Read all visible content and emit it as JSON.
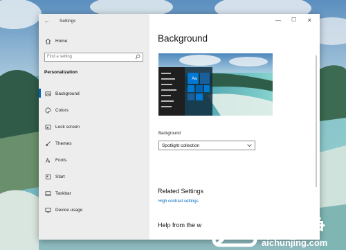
{
  "window": {
    "app_title": "Settings",
    "controls": {
      "minimize": "—",
      "maximize": "☐",
      "close": "✕"
    }
  },
  "sidebar": {
    "home_label": "Home",
    "search_placeholder": "Find a setting",
    "section_heading": "Personalization",
    "items": [
      {
        "label": "Background",
        "icon": "picture-icon",
        "active": true
      },
      {
        "label": "Colors",
        "icon": "palette-icon"
      },
      {
        "label": "Lock screen",
        "icon": "lock-screen-icon"
      },
      {
        "label": "Themes",
        "icon": "brush-icon"
      },
      {
        "label": "Fonts",
        "icon": "font-icon"
      },
      {
        "label": "Start",
        "icon": "start-icon"
      },
      {
        "label": "Taskbar",
        "icon": "taskbar-icon"
      },
      {
        "label": "Device usage",
        "icon": "device-icon"
      }
    ]
  },
  "main": {
    "title": "Background",
    "preview_sample_text": "Aa",
    "background_label": "Background",
    "background_value": "Spotlight collection",
    "related_heading": "Related Settings",
    "high_contrast_link": "High contrast settings",
    "help_heading": "Help from the w"
  },
  "watermark": {
    "chinese_text": "爱纯净",
    "url": "aichunjing.com"
  },
  "colors": {
    "accent": "#0078d4",
    "link": "#0067c0",
    "sidebar_bg": "#ededed"
  }
}
